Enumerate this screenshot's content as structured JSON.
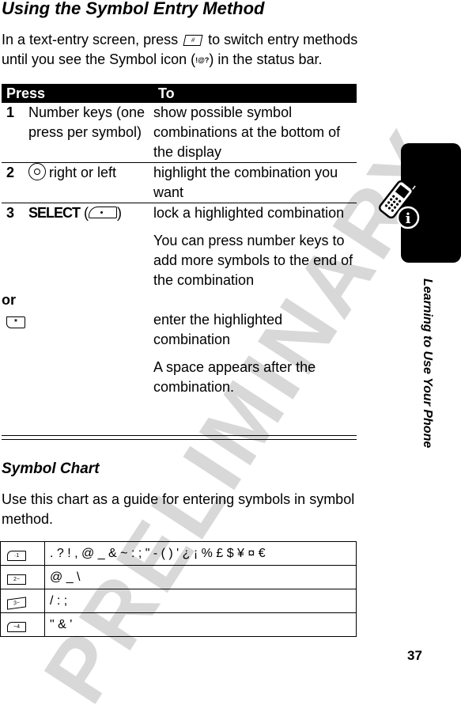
{
  "section_title": "Using the Symbol Entry Method",
  "intro": {
    "before_key": "In a text-entry screen, press",
    "key_icon": "pound-key-icon",
    "key_glyph": "#",
    "after_key": "to switch entry methods until you see the Symbol icon (",
    "symbol_icon_glyph": "!@?",
    "after_icon": ") in the status bar."
  },
  "press_table": {
    "headers": {
      "press": "Press",
      "to": "To"
    },
    "rows": [
      {
        "num": "1",
        "press": "Number keys (one press per symbol)",
        "to": [
          "show possible symbol combinations at the bottom of the display"
        ]
      },
      {
        "num": "2",
        "press_icon": "navigation-key-icon",
        "press": "right or left",
        "to": [
          "highlight the combination you want"
        ]
      },
      {
        "num": "3",
        "press_label": "SELECT",
        "press_icon": "right-soft-key-icon",
        "to": [
          "lock a highlighted combination",
          "You can press number keys to add more symbols to the end of the combination"
        ]
      }
    ],
    "or_label": "or",
    "alt_row": {
      "press_icon": "star-key-icon",
      "key_glyph": "*",
      "to": [
        "enter the highlighted combination",
        "A space appears after the combination."
      ]
    }
  },
  "symbol_chart": {
    "title": "Symbol Chart",
    "intro": "Use this chart as a guide for entering symbols in symbol method.",
    "rows": [
      {
        "key": "1",
        "key_label": "·1",
        "symbols": ". ? ! , @ _ & ~ : ; \" - ( ) ' ¿ ¡ % £ $ ¥ ¤ €"
      },
      {
        "key": "2",
        "key_label": "2−",
        "symbols": "@ _ \\"
      },
      {
        "key": "3",
        "key_label": "3−",
        "symbols": "/ : ;"
      },
      {
        "key": "4",
        "key_label": "−4",
        "symbols": "\" & '"
      }
    ]
  },
  "sidebar": {
    "chapter_title": "Learning to Use Your Phone",
    "icon": "phone-info-icon",
    "info_glyph": "i"
  },
  "watermark": "PRELIMINARY",
  "page_number": "37"
}
